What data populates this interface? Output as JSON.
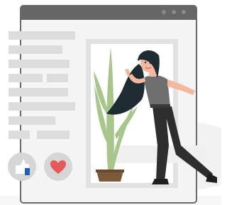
{
  "scene": {
    "window_chrome_color": "#666666",
    "window_frame_color": "#f4f4f4",
    "text_line_color": "#dcdcdc",
    "photo_frame_color": "#e2e2e2",
    "photo_bg_color": "#ffffff"
  },
  "icons": {
    "window_controls": [
      "dot-icon",
      "dot-icon",
      "dot-icon"
    ],
    "like": "thumbs-up-icon",
    "heart": "heart-icon"
  },
  "colors": {
    "like_blue": "#1f5fb4",
    "heart_red": "#e45a5a",
    "button_bg": "#d6d6d6",
    "plant_green": "#a8c58c",
    "pot_brown": "#7b5a3b",
    "hair_dark": "#1f2b33",
    "skin": "#f2b8a0",
    "shirt_gray": "#6e6e6e",
    "pants_dark": "#2e2e2e"
  }
}
